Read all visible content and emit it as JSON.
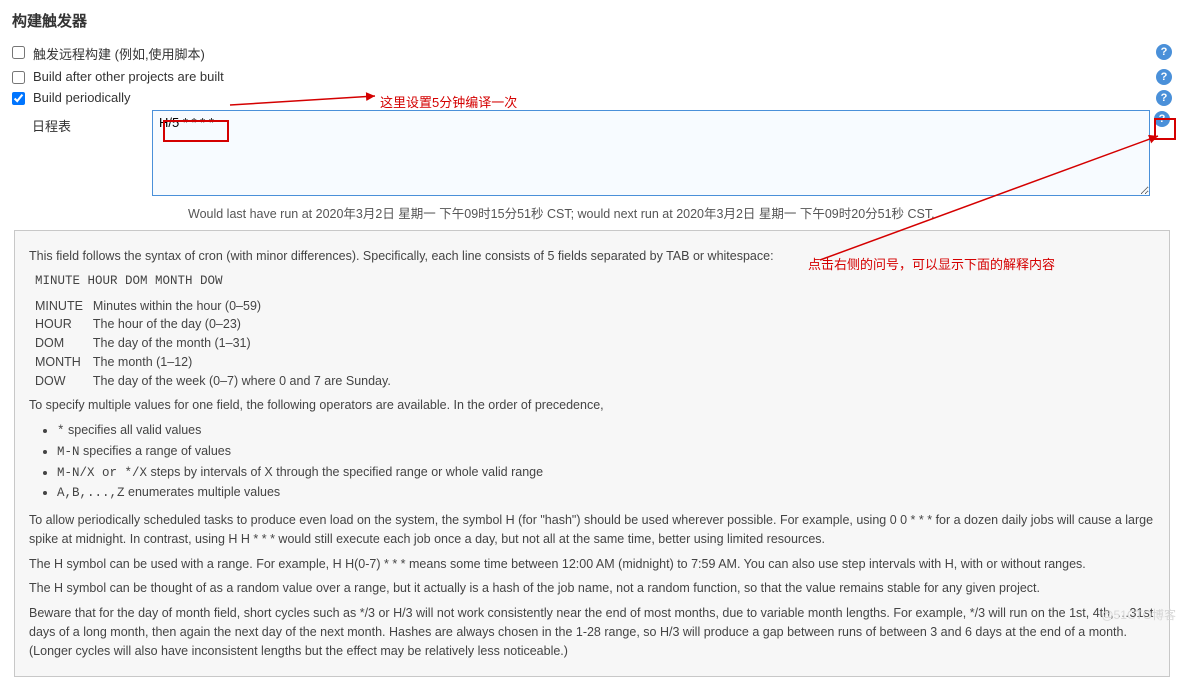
{
  "section_title": "构建触发器",
  "triggers": {
    "remote": {
      "label": "触发远程构建 (例如,使用脚本)",
      "checked": false
    },
    "after_projects": {
      "label": "Build after other projects are built",
      "checked": false
    },
    "periodically": {
      "label": "Build periodically",
      "checked": true
    }
  },
  "schedule": {
    "label": "日程表",
    "value": "H/5 * * * *",
    "last_run": "Would last have run at 2020年3月2日 星期一 下午09时15分51秒 CST; would next run at 2020年3月2日 星期一 下午09时20分51秒 CST."
  },
  "annotations": {
    "top": "这里设置5分钟编译一次",
    "right": "点击右侧的问号，可以显示下面的解释内容"
  },
  "help_text": {
    "intro": "This field follows the syntax of cron (with minor differences). Specifically, each line consists of 5 fields separated by TAB or whitespace:",
    "syntax_line": "MINUTE HOUR DOM MONTH DOW",
    "fields": [
      {
        "name": "MINUTE",
        "desc": "Minutes within the hour (0–59)"
      },
      {
        "name": "HOUR",
        "desc": "The hour of the day (0–23)"
      },
      {
        "name": "DOM",
        "desc": "The day of the month (1–31)"
      },
      {
        "name": "MONTH",
        "desc": "The month (1–12)"
      },
      {
        "name": "DOW",
        "desc": "The day of the week (0–7) where 0 and 7 are Sunday."
      }
    ],
    "operators_intro": "To specify multiple values for one field, the following operators are available. In the order of precedence,",
    "operators": [
      {
        "sym": "*",
        "desc": " specifies all valid values"
      },
      {
        "sym": "M-N",
        "desc": " specifies a range of values"
      },
      {
        "sym": "M-N/X or */X",
        "desc": " steps by intervals of X through the specified range or whole valid range"
      },
      {
        "sym": "A,B,...,Z",
        "desc": " enumerates multiple values"
      }
    ],
    "p_hash1": "To allow periodically scheduled tasks to produce even load on the system, the symbol H (for \"hash\") should be used wherever possible. For example, using 0 0 * * * for a dozen daily jobs will cause a large spike at midnight. In contrast, using H H * * * would still execute each job once a day, but not all at the same time, better using limited resources.",
    "p_hash2": "The H symbol can be used with a range. For example, H H(0-7) * * * means some time between 12:00 AM (midnight) to 7:59 AM. You can also use step intervals with H, with or without ranges.",
    "p_hash3": "The H symbol can be thought of as a random value over a range, but it actually is a hash of the job name, not a random function, so that the value remains stable for any given project.",
    "p_beware": "Beware that for the day of month field, short cycles such as */3 or H/3 will not work consistently near the end of most months, due to variable month lengths. For example, */3 will run on the 1st, 4th, …31st days of a long month, then again the next day of the next month. Hashes are always chosen in the 1-28 range, so H/3 will produce a gap between runs of between 3 and 6 days at the end of a month. (Longer cycles will also have inconsistent lengths but the effect may be relatively less noticeable.)"
  },
  "watermark": "@51CTO博客"
}
